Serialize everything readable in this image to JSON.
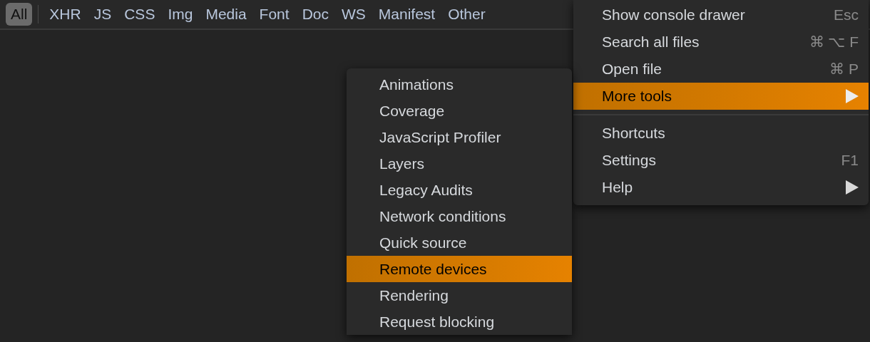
{
  "filter_bar": [
    {
      "label": "All",
      "selected": true
    },
    {
      "label": "XHR",
      "selected": false
    },
    {
      "label": "JS",
      "selected": false
    },
    {
      "label": "CSS",
      "selected": false
    },
    {
      "label": "Img",
      "selected": false
    },
    {
      "label": "Media",
      "selected": false
    },
    {
      "label": "Font",
      "selected": false
    },
    {
      "label": "Doc",
      "selected": false
    },
    {
      "label": "WS",
      "selected": false
    },
    {
      "label": "Manifest",
      "selected": false
    },
    {
      "label": "Other",
      "selected": false
    }
  ],
  "main_menu": {
    "groups": [
      [
        {
          "label": "Show console drawer",
          "shortcut": "Esc",
          "kind": "action",
          "selected": false
        },
        {
          "label": "Search all files",
          "shortcut": "⌘ ⌥ F",
          "kind": "action",
          "selected": false
        },
        {
          "label": "Open file",
          "shortcut": "⌘ P",
          "kind": "action",
          "selected": false
        },
        {
          "label": "More tools",
          "kind": "submenu",
          "selected": true
        }
      ],
      [
        {
          "label": "Shortcuts",
          "kind": "action",
          "selected": false
        },
        {
          "label": "Settings",
          "shortcut": "F1",
          "kind": "action",
          "selected": false
        },
        {
          "label": "Help",
          "kind": "submenu",
          "selected": false
        }
      ]
    ]
  },
  "more_tools_submenu": [
    {
      "label": "Animations",
      "selected": false
    },
    {
      "label": "Coverage",
      "selected": false
    },
    {
      "label": "JavaScript Profiler",
      "selected": false
    },
    {
      "label": "Layers",
      "selected": false
    },
    {
      "label": "Legacy Audits",
      "selected": false
    },
    {
      "label": "Network conditions",
      "selected": false
    },
    {
      "label": "Quick source",
      "selected": false
    },
    {
      "label": "Remote devices",
      "selected": true
    },
    {
      "label": "Rendering",
      "selected": false
    },
    {
      "label": "Request blocking",
      "selected": false
    }
  ]
}
